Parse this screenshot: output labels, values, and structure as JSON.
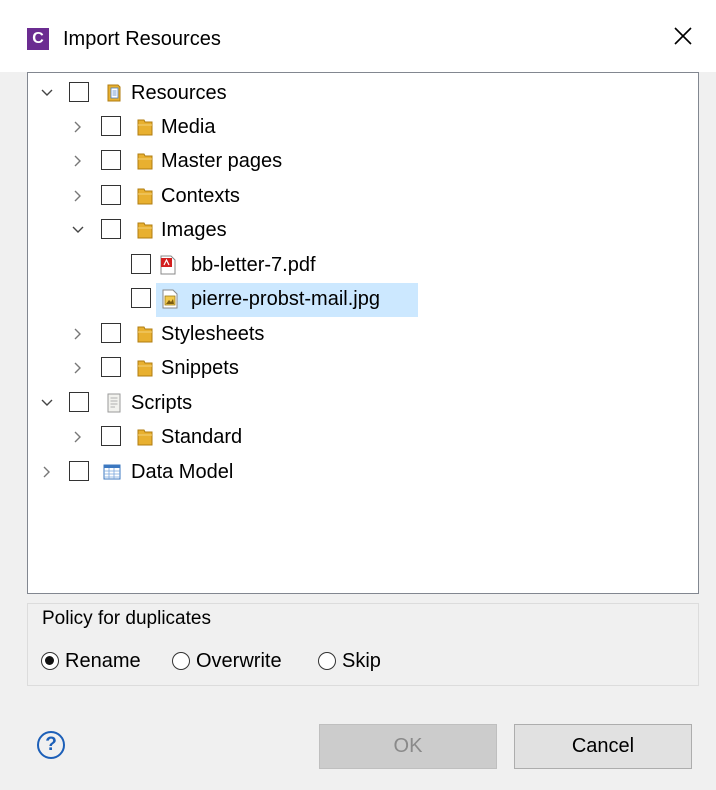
{
  "window": {
    "title": "Import Resources",
    "app_icon_letter": "C"
  },
  "tree": {
    "items": [
      {
        "label": "Resources",
        "expanded": true,
        "selected": false,
        "checked": false,
        "icon": "resources-folder-icon"
      },
      {
        "label": "Media",
        "expanded": false,
        "selected": false,
        "checked": false,
        "icon": "folder-icon"
      },
      {
        "label": "Master pages",
        "expanded": false,
        "selected": false,
        "checked": false,
        "icon": "folder-icon"
      },
      {
        "label": "Contexts",
        "expanded": false,
        "selected": false,
        "checked": false,
        "icon": "folder-icon"
      },
      {
        "label": "Images",
        "expanded": true,
        "selected": false,
        "checked": false,
        "icon": "folder-icon"
      },
      {
        "label": "bb-letter-7.pdf",
        "selected": false,
        "checked": false,
        "icon": "pdf-file-icon"
      },
      {
        "label": "pierre-probst-mail.jpg",
        "selected": true,
        "checked": false,
        "icon": "image-file-icon"
      },
      {
        "label": "Stylesheets",
        "expanded": false,
        "selected": false,
        "checked": false,
        "icon": "folder-icon"
      },
      {
        "label": "Snippets",
        "expanded": false,
        "selected": false,
        "checked": false,
        "icon": "folder-icon"
      },
      {
        "label": "Scripts",
        "expanded": true,
        "selected": false,
        "checked": false,
        "icon": "scripts-icon"
      },
      {
        "label": "Standard",
        "expanded": false,
        "selected": false,
        "checked": false,
        "icon": "folder-icon"
      },
      {
        "label": "Data Model",
        "expanded": false,
        "selected": false,
        "checked": false,
        "icon": "data-model-icon"
      }
    ]
  },
  "policy": {
    "title": "Policy for duplicates",
    "options": [
      "Rename",
      "Overwrite",
      "Skip"
    ],
    "selected": "Rename"
  },
  "buttons": {
    "ok": "OK",
    "cancel": "Cancel",
    "help_glyph": "?"
  },
  "colors": {
    "selection": "#cce8ff",
    "app_icon": "#6b2c91",
    "folder": "#e8b030"
  }
}
